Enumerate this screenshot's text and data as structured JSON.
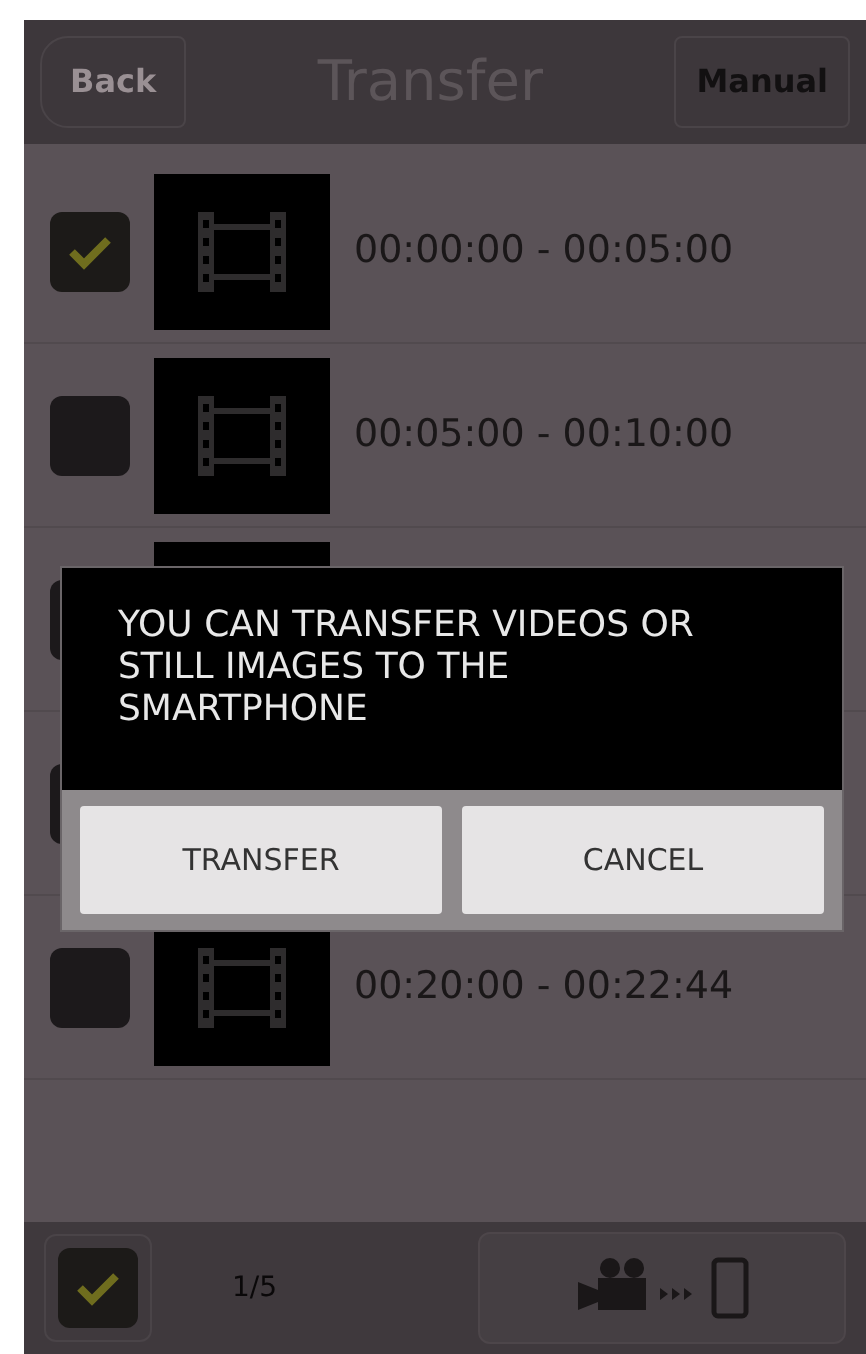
{
  "header": {
    "back": "Back",
    "title": "Transfer",
    "manual": "Manual"
  },
  "clips": [
    {
      "kind": "visible",
      "checked": true,
      "time": "00:00:00 - 00:05:00"
    },
    {
      "kind": "visible",
      "checked": false,
      "time": "00:05:00 - 00:10:00"
    },
    {
      "kind": "covered"
    },
    {
      "kind": "covered"
    },
    {
      "kind": "visible",
      "checked": false,
      "time": "00:20:00 - 00:22:44"
    }
  ],
  "dialog": {
    "message": "YOU CAN TRANSFER VIDEOS OR STILL IMAGES TO THE SMARTPHONE",
    "buttons": [
      "TRANSFER",
      "CANCEL"
    ]
  },
  "footer": {
    "select_all_checked": true,
    "count": "1/5"
  }
}
